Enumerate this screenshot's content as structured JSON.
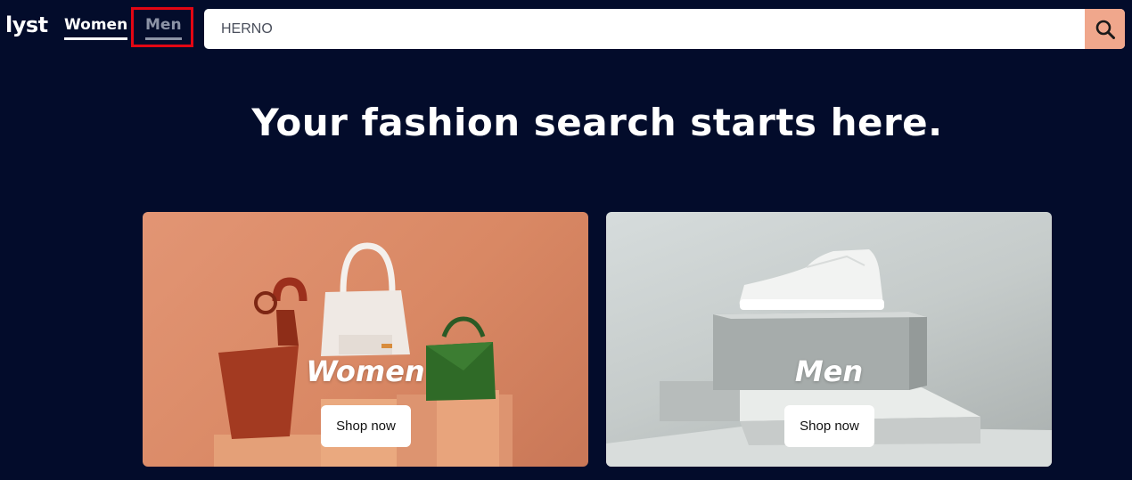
{
  "header": {
    "logo": "lyst",
    "nav": [
      {
        "label": "Women",
        "active": true
      },
      {
        "label": "Men",
        "active": false,
        "highlighted": true
      }
    ],
    "search": {
      "value": "HERNO",
      "icon": "search-icon"
    }
  },
  "main": {
    "headline": "Your fashion search starts here.",
    "cards": [
      {
        "title": "Women",
        "button_label": "Shop now"
      },
      {
        "title": "Men",
        "button_label": "Shop now"
      }
    ]
  },
  "colors": {
    "background": "#030c2b",
    "accent": "#f0a78c",
    "highlight": "#e30613"
  }
}
